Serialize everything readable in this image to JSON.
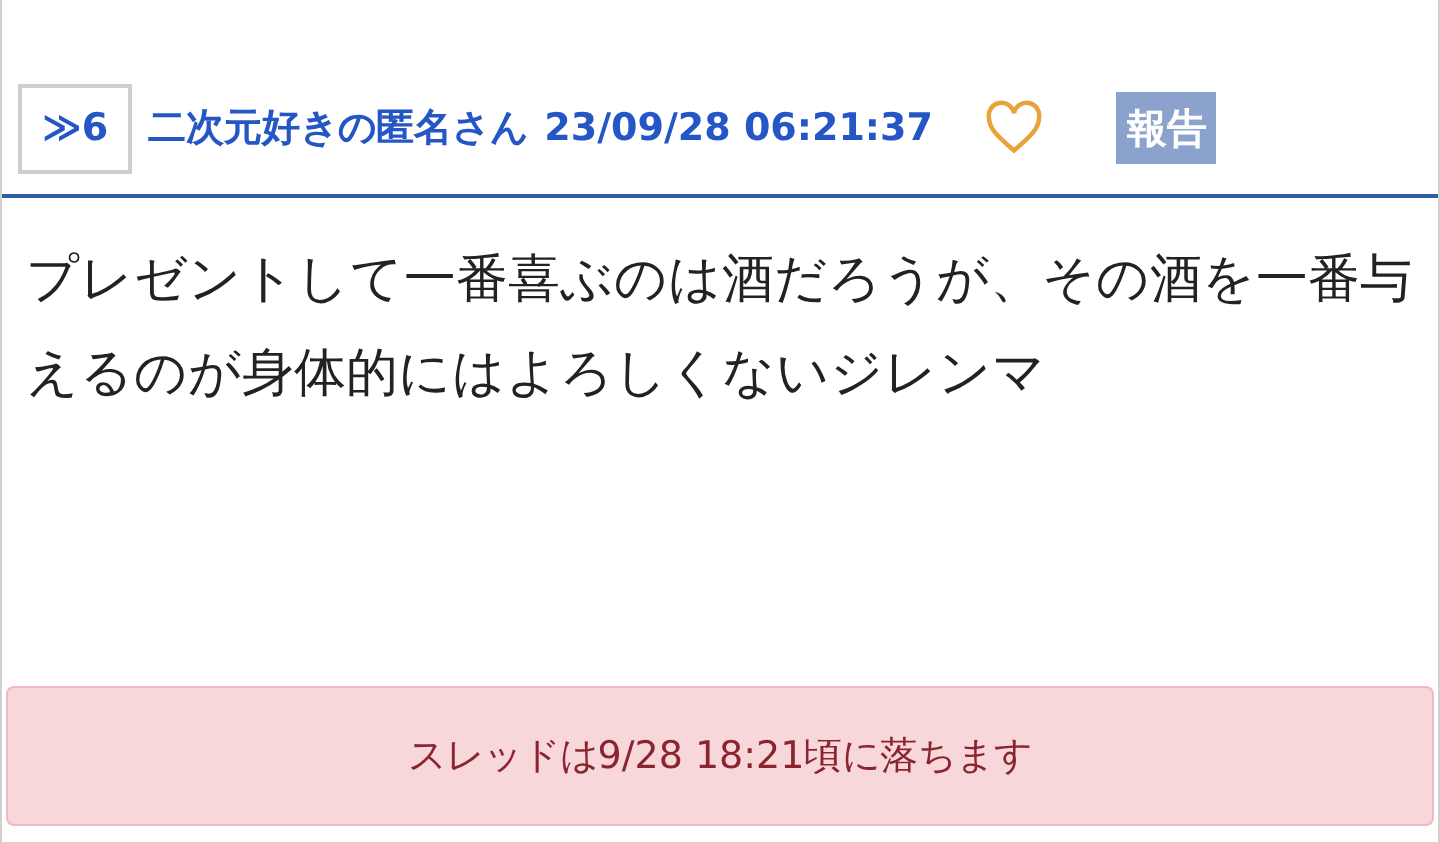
{
  "post": {
    "number": "≫6",
    "author": "二次元好きの匿名さん",
    "date": "23/09/28 06:21:37",
    "liked": false,
    "report": "報告",
    "body": "プレゼントして一番喜ぶのは酒だろうが、その酒を一番与えるのが身体的にはよろしくないジレンマ"
  },
  "notice": "スレッドは9/28 18:21頃に落ちます"
}
